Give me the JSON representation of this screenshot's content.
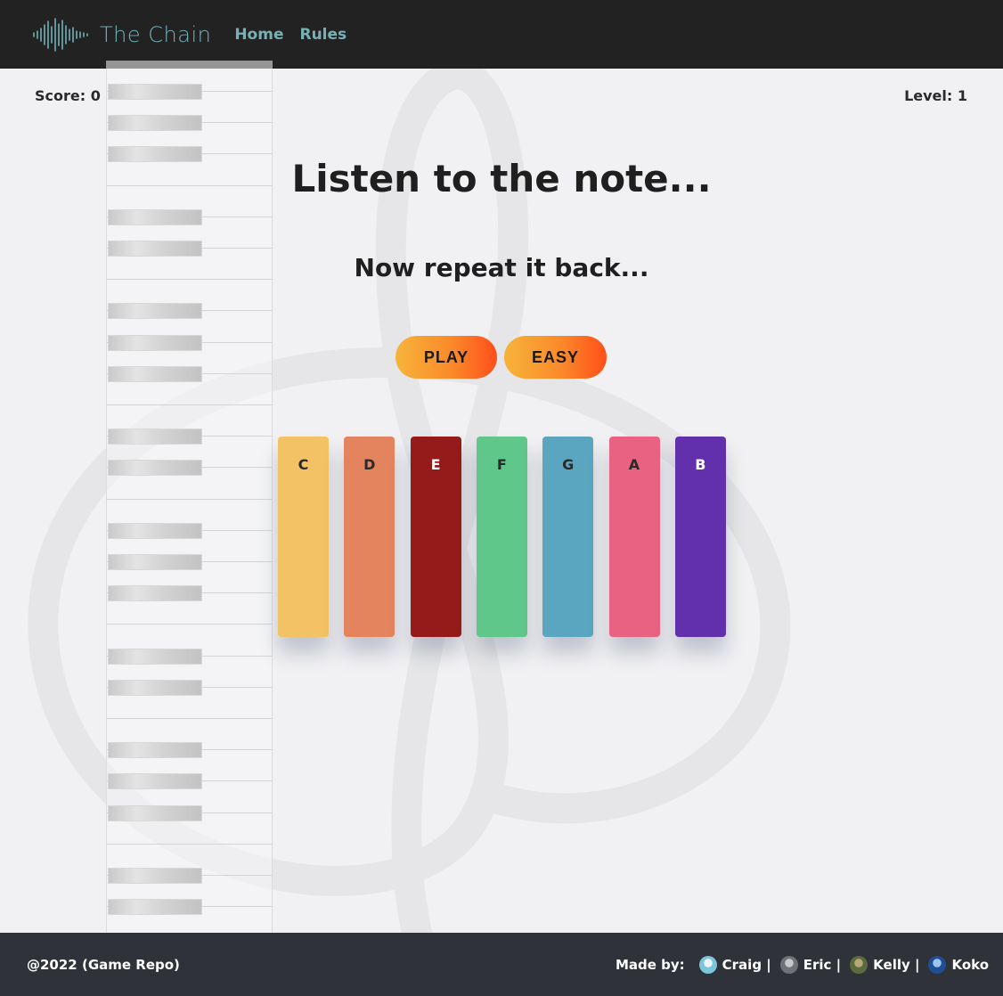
{
  "header": {
    "brand_name": "The Chain",
    "nav": [
      {
        "label": "Home"
      },
      {
        "label": "Rules"
      }
    ]
  },
  "hud": {
    "score": "Score: 0",
    "level": "Level: 1"
  },
  "main": {
    "headline": "Listen to the note...",
    "subline": "Now repeat it back...",
    "play_label": "PLAY",
    "easy_label": "EASY"
  },
  "notes": [
    {
      "label": "C",
      "color": "#f3c264",
      "text_color": "#2a2a2a"
    },
    {
      "label": "D",
      "color": "#e3845f",
      "text_color": "#2a2a2a"
    },
    {
      "label": "E",
      "color": "#951b1a",
      "text_color": "#ffffff"
    },
    {
      "label": "F",
      "color": "#5ec789",
      "text_color": "#2a2a2a"
    },
    {
      "label": "G",
      "color": "#5aa5bf",
      "text_color": "#2a2a2a"
    },
    {
      "label": "A",
      "color": "#ea6281",
      "text_color": "#2a2a2a"
    },
    {
      "label": "B",
      "color": "#622fad",
      "text_color": "#ffffff"
    }
  ],
  "footer": {
    "copyright": "@2022 (Game Repo)",
    "made_by": "Made by:",
    "members": [
      {
        "name": "Craig |",
        "avatar_color": "#7cc6dc"
      },
      {
        "name": "Eric |",
        "avatar_color": "#8a8d92"
      },
      {
        "name": "Kelly |",
        "avatar_color": "#7a7a52"
      },
      {
        "name": "Koko",
        "avatar_color": "#2a5fa8"
      }
    ]
  },
  "colors": {
    "topbar": "#222222",
    "brand": "#6fb3b8",
    "button_gradient_start": "#f7b33a",
    "button_gradient_end": "#ff4f1a",
    "footer": "#2f3238"
  }
}
